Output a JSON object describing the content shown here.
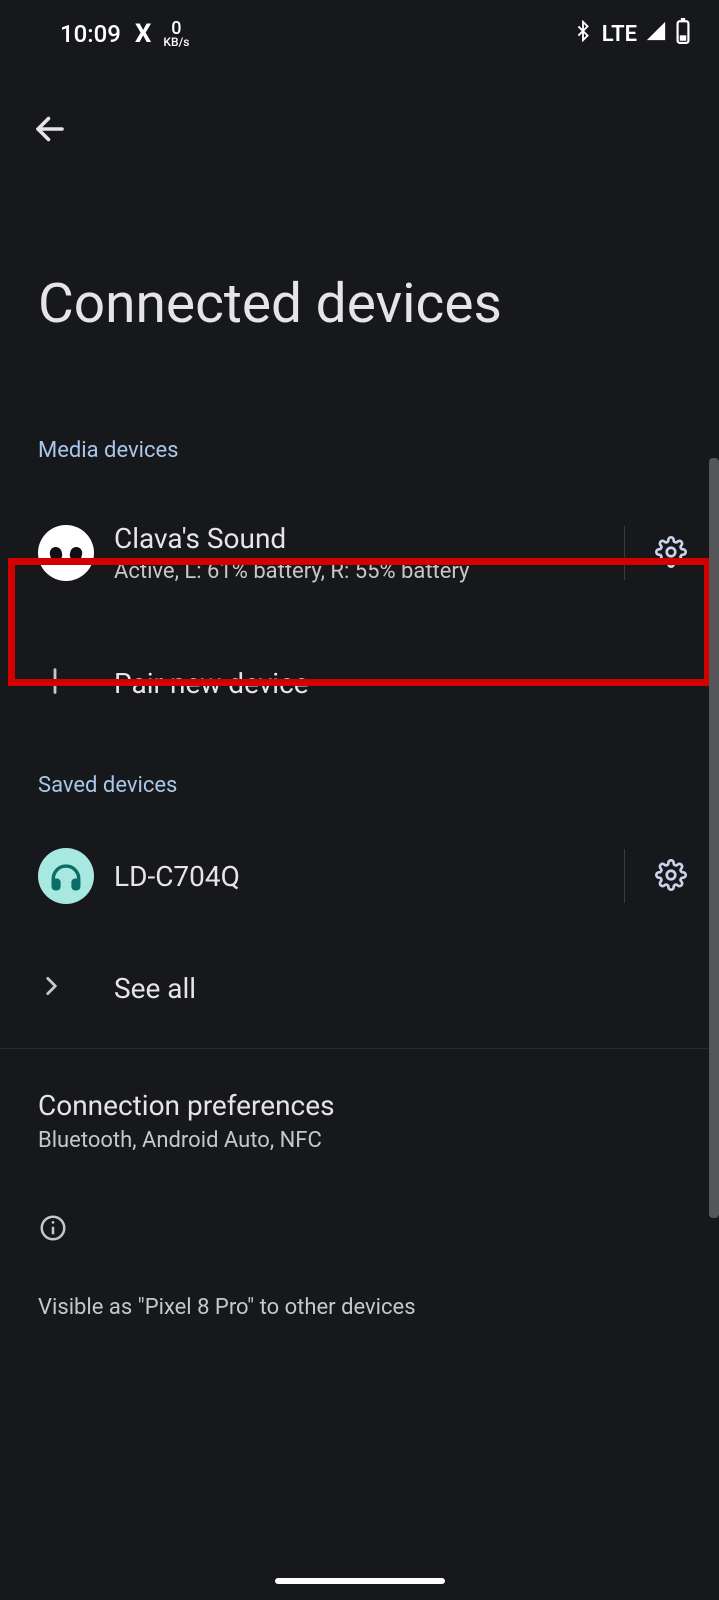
{
  "status": {
    "time": "10:09",
    "app_icon": "X",
    "net_speed_value": "0",
    "net_speed_unit": "KB/s",
    "network_label": "LTE"
  },
  "header": {
    "title": "Connected devices"
  },
  "sections": {
    "media_label": "Media devices",
    "saved_label": "Saved devices"
  },
  "media": {
    "device_name": "Clava's Sound",
    "device_sub": "Active, L: 61% battery, R: 55% battery"
  },
  "pair": {
    "label": "Pair new device"
  },
  "saved": {
    "device_name": "LD-C704Q",
    "see_all_label": "See all"
  },
  "prefs": {
    "title": "Connection preferences",
    "sub": "Bluetooth, Android Auto, NFC"
  },
  "visibility": {
    "text": "Visible as \"Pixel 8 Pro\" to other devices"
  }
}
